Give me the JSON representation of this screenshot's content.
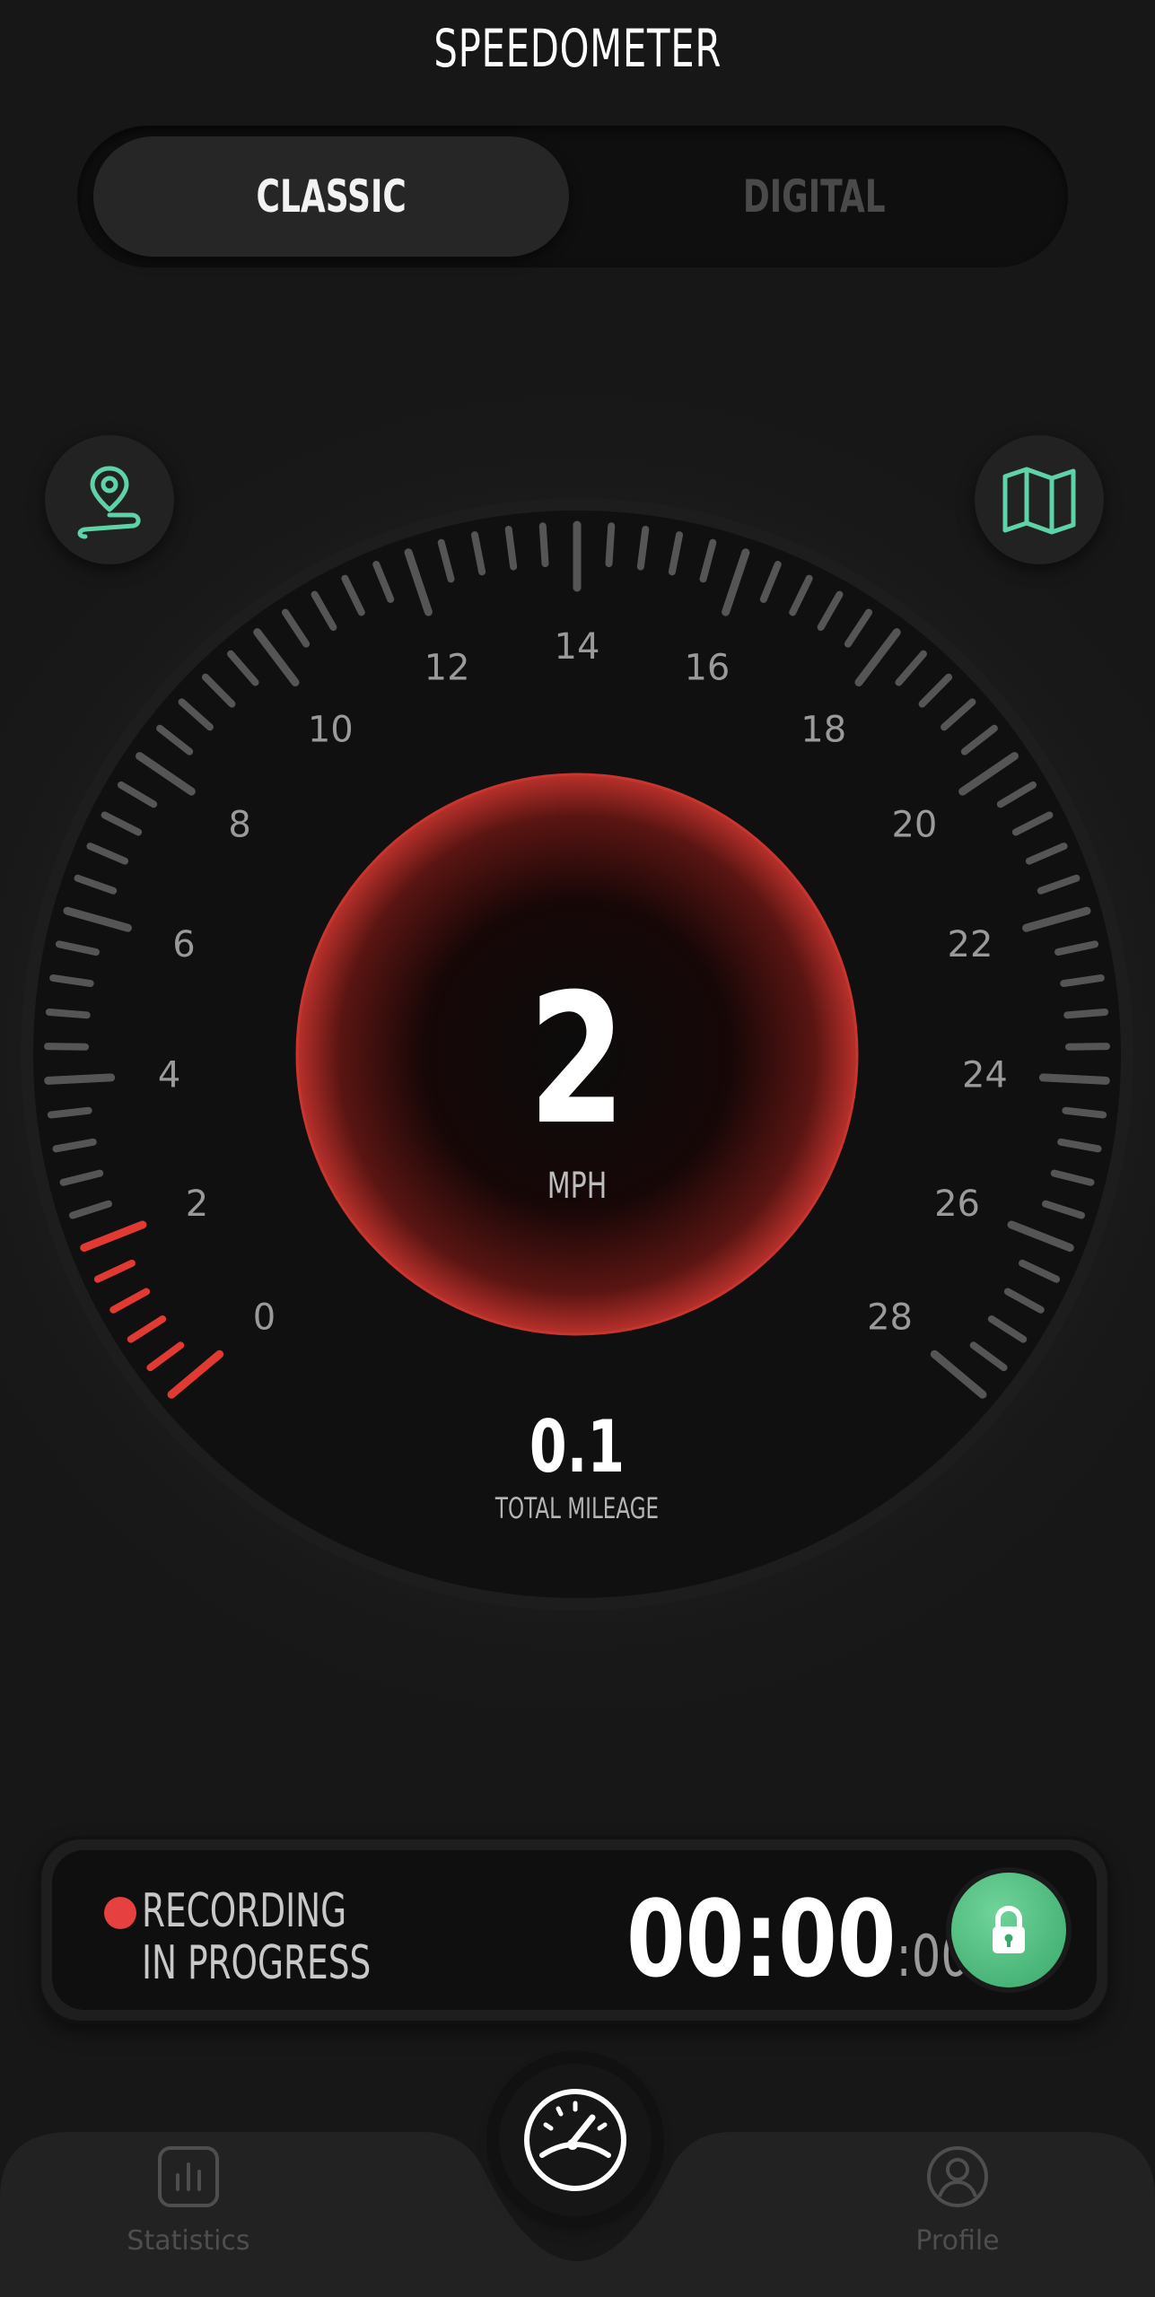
{
  "header": {
    "title": "SPEEDOMETER"
  },
  "mode_toggle": {
    "options": [
      "CLASSIC",
      "DIGITAL"
    ],
    "selected": "CLASSIC"
  },
  "gauge": {
    "min": 0,
    "max": 28,
    "tick_labels": [
      "0",
      "2",
      "4",
      "6",
      "8",
      "10",
      "12",
      "14",
      "16",
      "18",
      "20",
      "22",
      "24",
      "26",
      "28"
    ],
    "current_speed": "2",
    "speed_value": 2,
    "unit": "MPH",
    "total_mileage": "0.1",
    "total_mileage_label": "TOTAL MILEAGE",
    "colors": {
      "accent": "#e03a33",
      "tick": "#555555",
      "label": "#9a9a9a"
    }
  },
  "route_button": {
    "icon": "route-pin-icon",
    "color": "#5ed3a8"
  },
  "map_button": {
    "icon": "map-icon",
    "color": "#5ed3a8"
  },
  "recording": {
    "line1": "RECORDING",
    "line2": "IN PROGRESS",
    "timer": "00:00",
    "timer_fraction": ":00",
    "status_color": "#e64040",
    "lock_icon": "lock-icon"
  },
  "bottom_nav": {
    "items": [
      {
        "label": "Statistics",
        "icon": "bar-chart-icon"
      },
      {
        "label": "Profile",
        "icon": "user-icon"
      }
    ],
    "center_icon": "speedometer-icon"
  }
}
